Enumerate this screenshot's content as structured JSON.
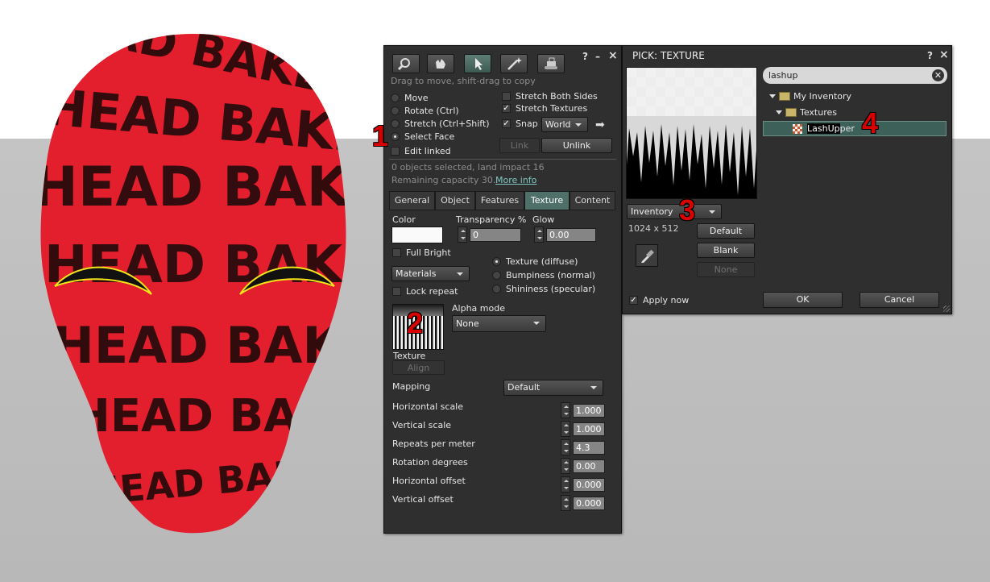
{
  "scene": {
    "head_text": "HEAD BAKED",
    "head_color": "#e31e2d"
  },
  "build_tool": {
    "tool_icons": [
      "zoom-icon",
      "grab-hand-icon",
      "select-arrow-icon",
      "magic-wand-icon",
      "land-bulldozer-icon"
    ],
    "help": "?",
    "minimize": "–",
    "close": "×",
    "hint": "Drag to move, shift-drag to copy",
    "modes": [
      {
        "label": "Move",
        "selected": false
      },
      {
        "label": "Rotate (Ctrl)",
        "selected": false
      },
      {
        "label": "Stretch (Ctrl+Shift)",
        "selected": false
      },
      {
        "label": "Select Face",
        "selected": true
      }
    ],
    "edit_linked": "Edit linked",
    "stretch_both": "Stretch Both Sides",
    "stretch_textures": "Stretch Textures",
    "snap": "Snap",
    "snap_mode": "World",
    "link": "Link",
    "unlink": "Unlink",
    "status_line": "0 objects selected, land impact 16",
    "capacity": "Remaining capacity 30.",
    "more_info": "More info",
    "tabs": [
      "General",
      "Object",
      "Features",
      "Texture",
      "Content"
    ],
    "active_tab": "Texture",
    "color_label": "Color",
    "transparency_label": "Transparency %",
    "transparency_value": "0",
    "glow_label": "Glow",
    "glow_value": "0.00",
    "full_bright": "Full Bright",
    "materials": "Materials",
    "material_modes": [
      "Texture (diffuse)",
      "Bumpiness (normal)",
      "Shininess (specular)"
    ],
    "lock_repeat": "Lock repeat",
    "alpha_mode_label": "Alpha mode",
    "alpha_mode": "None",
    "texture_label": "Texture",
    "align": "Align",
    "mapping_label": "Mapping",
    "mapping": "Default",
    "params": [
      {
        "label": "Horizontal scale",
        "value": "1.000"
      },
      {
        "label": "Vertical scale",
        "value": "1.000"
      },
      {
        "label": "Repeats per meter",
        "value": "4.3"
      },
      {
        "label": "Rotation degrees",
        "value": "0.00"
      },
      {
        "label": "Horizontal offset",
        "value": "0.000"
      },
      {
        "label": "Vertical offset",
        "value": "0.000"
      }
    ]
  },
  "picker": {
    "title": "PICK: TEXTURE",
    "help": "?",
    "close": "×",
    "search": "lashup",
    "tree": {
      "root": "My Inventory",
      "folder": "Textures",
      "item_highlight": "LashUp",
      "item_rest": "per"
    },
    "source": "Inventory",
    "dimensions": "1024 x 512",
    "default": "Default",
    "blank": "Blank",
    "none": "None",
    "apply_now": "Apply now",
    "ok": "OK",
    "cancel": "Cancel"
  },
  "annotations": [
    "1",
    "2",
    "3",
    "4"
  ]
}
